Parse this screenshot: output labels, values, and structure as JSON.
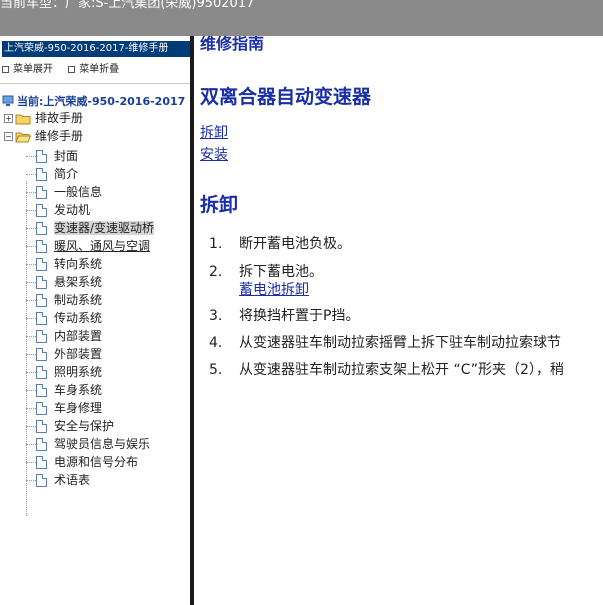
{
  "topbar": {
    "title": "当前车型：厂家:S-上汽集团(荣威)9502017"
  },
  "sidebar": {
    "model_title": "上汽荣威-950-2016-2017-维修手册",
    "expand_label": "菜单展开",
    "collapse_label": "菜单折叠",
    "current_label": "当前:上汽荣威-950-2016-2017",
    "roots": [
      {
        "label": "排故手册",
        "toggle": "+"
      },
      {
        "label": "维修手册",
        "toggle": "−"
      }
    ],
    "items": [
      "封面",
      "简介",
      "一般信息",
      "发动机",
      "变速器/变速驱动桥",
      "暖风、通风与空调",
      "转向系统",
      "悬架系统",
      "制动系统",
      "传动系统",
      "内部装置",
      "外部装置",
      "照明系统",
      "车身系统",
      "车身修理",
      "安全与保护",
      "驾驶员信息与娱乐",
      "电源和信号分布",
      "术语表"
    ]
  },
  "content": {
    "doc_title": "维修指南",
    "section_title": "双离合器自动变速器",
    "toc": [
      "拆卸",
      "安装"
    ],
    "sub_title": "拆卸",
    "steps": [
      {
        "num": "1.",
        "text": "断开蓄电池负极。"
      },
      {
        "num": "2.",
        "text": "拆下蓄电池。"
      },
      {
        "num": "3.",
        "text": "将换挡杆置于P挡。"
      },
      {
        "num": "4.",
        "text": "从变速器驻车制动拉索摇臂上拆下驻车制动拉索球节"
      },
      {
        "num": "5.",
        "text": "从变速器驻车制动拉索支架上松开 “C”形夹（2），稍"
      }
    ],
    "step2_link": "蓄电池拆卸"
  }
}
